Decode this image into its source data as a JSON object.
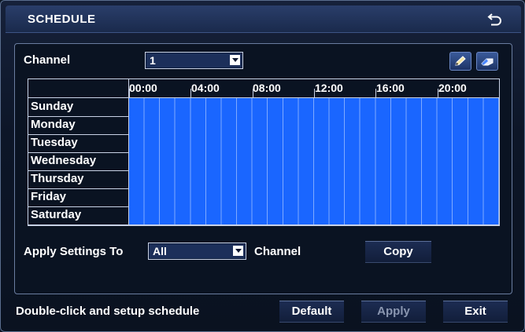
{
  "window": {
    "title": "SCHEDULE"
  },
  "channel": {
    "label": "Channel",
    "selected": "1"
  },
  "tools": {
    "pencil_icon": "pencil-icon",
    "eraser_icon": "eraser-icon"
  },
  "schedule": {
    "hours": [
      "00:00",
      "04:00",
      "08:00",
      "12:00",
      "16:00",
      "20:00"
    ],
    "days": [
      "Sunday",
      "Monday",
      "Tuesday",
      "Wednesday",
      "Thursday",
      "Friday",
      "Saturday"
    ],
    "active_color": "#1a66ff"
  },
  "apply_to": {
    "label": "Apply Settings To",
    "selected": "All",
    "suffix": "Channel",
    "copy_label": "Copy"
  },
  "footer": {
    "hint": "Double-click and setup schedule",
    "default_label": "Default",
    "apply_label": "Apply",
    "exit_label": "Exit"
  }
}
